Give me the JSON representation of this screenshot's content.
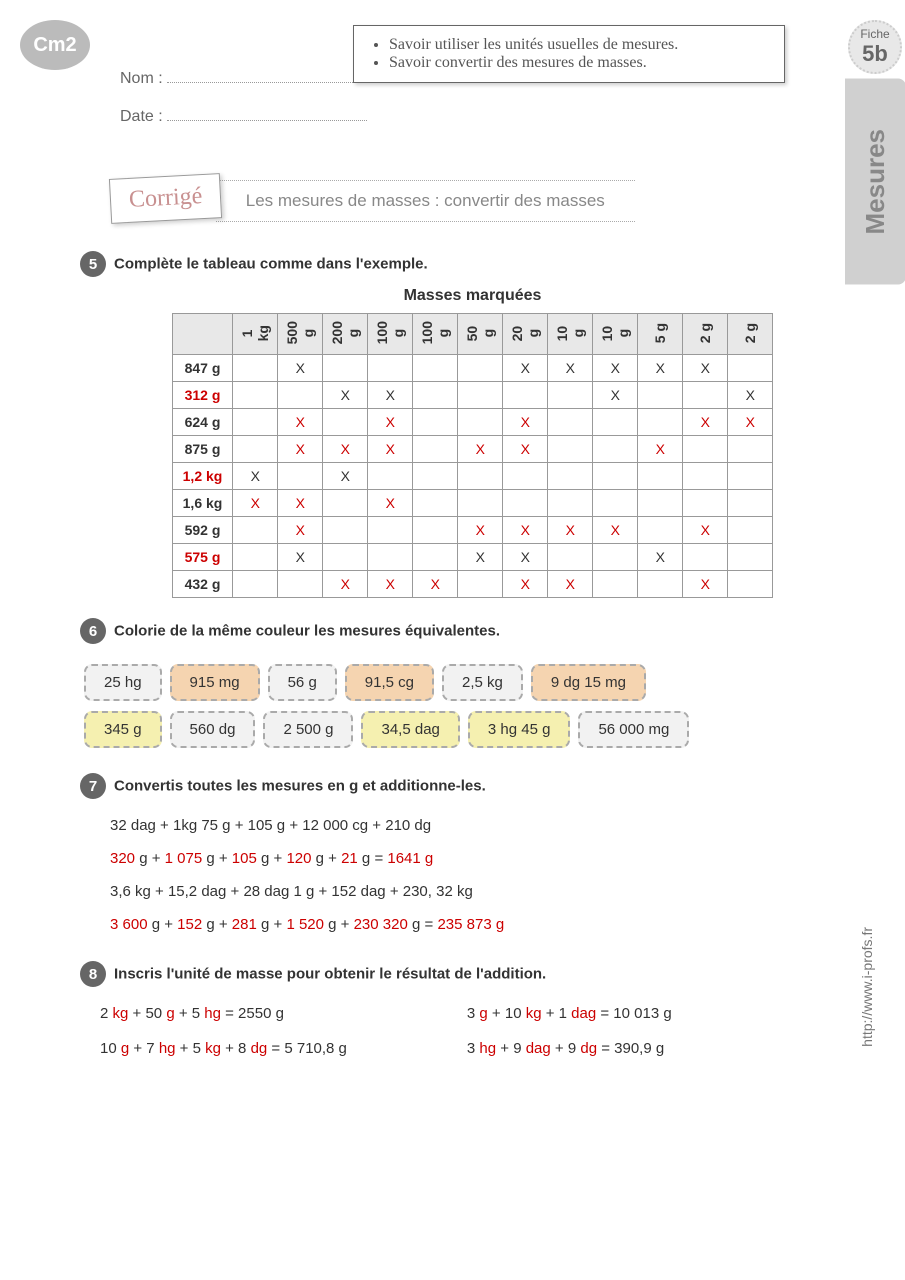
{
  "grade": "Cm2",
  "fields": {
    "name_label": "Nom :",
    "date_label": "Date :"
  },
  "objectives": [
    "Savoir utiliser les unités usuelles de mesures.",
    "Savoir convertir des mesures de masses."
  ],
  "fiche": {
    "label": "Fiche",
    "num": "5b"
  },
  "side_label": "Mesures",
  "corrige": "Corrigé",
  "page_title": "Les mesures de masses : convertir des masses",
  "ex5": {
    "num": "5",
    "title": "Complète le tableau comme dans l'exemple.",
    "table_title": "Masses marquées",
    "headers": [
      "1 kg",
      "500 g",
      "200 g",
      "100 g",
      "100 g",
      "50 g",
      "20 g",
      "10 g",
      "10 g",
      "5 g",
      "2 g",
      "2 g"
    ],
    "rows": [
      {
        "label": "847 g",
        "red": false,
        "marks": [
          "",
          "X",
          "",
          "",
          "",
          "",
          "X",
          "X",
          "X",
          "X",
          "X",
          ""
        ],
        "mred": [
          0,
          0,
          0,
          0,
          0,
          0,
          0,
          0,
          0,
          0,
          0,
          0
        ]
      },
      {
        "label": "312 g",
        "red": true,
        "marks": [
          "",
          "",
          "X",
          "X",
          "",
          "",
          "",
          "",
          "X",
          "",
          "",
          "X"
        ],
        "mred": [
          0,
          0,
          0,
          0,
          0,
          0,
          0,
          0,
          0,
          0,
          0,
          0
        ]
      },
      {
        "label": "624 g",
        "red": false,
        "marks": [
          "",
          "X",
          "",
          "X",
          "",
          "",
          "X",
          "",
          "",
          "",
          "X",
          "X"
        ],
        "mred": [
          0,
          1,
          0,
          1,
          0,
          0,
          1,
          0,
          0,
          0,
          1,
          1
        ]
      },
      {
        "label": "875 g",
        "red": false,
        "marks": [
          "",
          "X",
          "X",
          "X",
          "",
          "X",
          "X",
          "",
          "",
          "X",
          "",
          ""
        ],
        "mred": [
          0,
          1,
          1,
          1,
          0,
          1,
          1,
          0,
          0,
          1,
          0,
          0
        ]
      },
      {
        "label": "1,2 kg",
        "red": true,
        "marks": [
          "X",
          "",
          "X",
          "",
          "",
          "",
          "",
          "",
          "",
          "",
          "",
          ""
        ],
        "mred": [
          0,
          0,
          0,
          0,
          0,
          0,
          0,
          0,
          0,
          0,
          0,
          0
        ]
      },
      {
        "label": "1,6 kg",
        "red": false,
        "marks": [
          "X",
          "X",
          "",
          "X",
          "",
          "",
          "",
          "",
          "",
          "",
          "",
          ""
        ],
        "mred": [
          1,
          1,
          0,
          1,
          0,
          0,
          0,
          0,
          0,
          0,
          0,
          0
        ]
      },
      {
        "label": "592 g",
        "red": false,
        "marks": [
          "",
          "X",
          "",
          "",
          "",
          "X",
          "X",
          "X",
          "X",
          "",
          "X",
          ""
        ],
        "mred": [
          0,
          1,
          0,
          0,
          0,
          1,
          1,
          1,
          1,
          0,
          1,
          0
        ]
      },
      {
        "label": "575 g",
        "red": true,
        "marks": [
          "",
          "X",
          "",
          "",
          "",
          "X",
          "X",
          "",
          "",
          "X",
          "",
          ""
        ],
        "mred": [
          0,
          0,
          0,
          0,
          0,
          0,
          0,
          0,
          0,
          0,
          0,
          0
        ]
      },
      {
        "label": "432 g",
        "red": false,
        "marks": [
          "",
          "",
          "X",
          "X",
          "X",
          "",
          "X",
          "X",
          "",
          "",
          "X",
          ""
        ],
        "mred": [
          0,
          0,
          1,
          1,
          1,
          0,
          1,
          1,
          0,
          0,
          1,
          0
        ]
      }
    ]
  },
  "ex6": {
    "num": "6",
    "title": "Colorie de la même couleur les mesures équivalentes.",
    "chips": [
      {
        "t": "25 hg",
        "c": "gray"
      },
      {
        "t": "915 mg",
        "c": "orange"
      },
      {
        "t": "56 g",
        "c": "gray"
      },
      {
        "t": "91,5 cg",
        "c": "orange"
      },
      {
        "t": "2,5 kg",
        "c": "gray"
      },
      {
        "t": "9 dg 15 mg",
        "c": "orange"
      },
      {
        "t": "345 g",
        "c": "yellow"
      },
      {
        "t": "560 dg",
        "c": "gray"
      },
      {
        "t": "2 500 g",
        "c": "gray"
      },
      {
        "t": "34,5 dag",
        "c": "yellow"
      },
      {
        "t": "3 hg 45 g",
        "c": "yellow"
      },
      {
        "t": "56 000 mg",
        "c": "gray"
      }
    ]
  },
  "ex7": {
    "num": "7",
    "title": "Convertis toutes les mesures en g et additionne-les.",
    "l1": "32 dag + 1kg 75 g + 105 g + 12 000 cg + 210 dg",
    "l2": {
      "p": [
        "320",
        "1 075",
        "105",
        "120",
        "21"
      ],
      "r": "1641 g"
    },
    "l3": "3,6 kg + 15,2 dag + 28 dag 1 g + 152 dag + 230, 32 kg",
    "l4": {
      "p": [
        "3 600",
        "152",
        "281",
        "1 520",
        "230 320"
      ],
      "r": "235 873 g"
    }
  },
  "ex8": {
    "num": "8",
    "title": "Inscris l'unité de masse pour obtenir le résultat de l'addition.",
    "lines": [
      [
        {
          "t": "2 "
        },
        {
          "t": "kg",
          "r": 1
        },
        {
          "t": " + 50 "
        },
        {
          "t": "g",
          "r": 1
        },
        {
          "t": " + 5 "
        },
        {
          "t": "hg",
          "r": 1
        },
        {
          "t": " = 2550 g"
        }
      ],
      [
        {
          "t": "3 "
        },
        {
          "t": "g",
          "r": 1
        },
        {
          "t": " + 10 "
        },
        {
          "t": "kg",
          "r": 1
        },
        {
          "t": " + 1 "
        },
        {
          "t": "dag",
          "r": 1
        },
        {
          "t": " = 10 013 g"
        }
      ],
      [
        {
          "t": "10 "
        },
        {
          "t": "g",
          "r": 1
        },
        {
          "t": " + 7 "
        },
        {
          "t": "hg",
          "r": 1
        },
        {
          "t": " + 5 "
        },
        {
          "t": "kg",
          "r": 1
        },
        {
          "t": " + 8 "
        },
        {
          "t": "dg",
          "r": 1
        },
        {
          "t": " = 5 710,8 g"
        }
      ],
      [
        {
          "t": "3 "
        },
        {
          "t": "hg",
          "r": 1
        },
        {
          "t": " + 9 "
        },
        {
          "t": "dag",
          "r": 1
        },
        {
          "t": " + 9 "
        },
        {
          "t": "dg",
          "r": 1
        },
        {
          "t": " = 390,9 g"
        }
      ]
    ]
  },
  "source_url": "http://www.i-profs.fr"
}
